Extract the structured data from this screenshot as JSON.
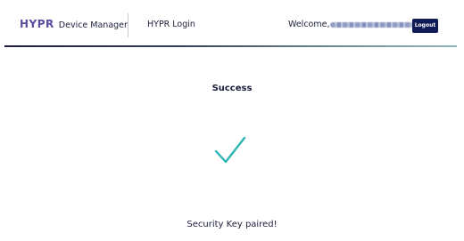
{
  "header": {
    "logo_mark": "HYPR",
    "logo_product": "Device Manager",
    "app_name": "HYPR Login",
    "welcome_label": "Welcome,",
    "logout_label": "Logout"
  },
  "main": {
    "title": "Success",
    "message": "Security Key paired!"
  },
  "icons": {
    "success": "checkmark-icon"
  },
  "colors": {
    "brand": "#5a4c9f",
    "logout_bg": "#0f1a57",
    "checkmark": "#2bb5b2",
    "text": "#1c1f3a"
  }
}
